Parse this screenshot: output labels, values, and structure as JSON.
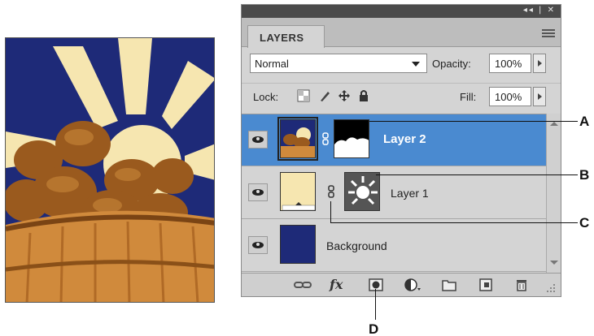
{
  "panel": {
    "tab_label": "LAYERS",
    "window_controls": "◂◂ | ✕",
    "blend_mode": "Normal",
    "opacity_label": "Opacity:",
    "opacity_value": "100%",
    "lock_label": "Lock:",
    "fill_label": "Fill:",
    "fill_value": "100%",
    "lock_icons": [
      "lock-transparent-pixels-icon",
      "lock-image-pixels-icon",
      "lock-position-icon",
      "lock-all-icon"
    ],
    "layers": [
      {
        "name": "Layer 2",
        "selected": true,
        "thumbnail": "potatoes-photo",
        "has_mask": true
      },
      {
        "name": "Layer 1",
        "selected": false,
        "thumbnail": "cream-fill",
        "has_mask": true,
        "mask": "sun-shape"
      },
      {
        "name": "Background",
        "selected": false,
        "thumbnail": "navy-fill",
        "has_mask": false
      }
    ],
    "bottom_icons": [
      "link-layers-icon",
      "fx-layer-style-icon",
      "add-mask-icon",
      "adjustment-layer-icon",
      "new-group-icon",
      "new-layer-icon",
      "delete-layer-icon"
    ],
    "fx_label": "fx"
  },
  "callouts": {
    "a": "A",
    "b": "B",
    "c": "C",
    "d": "D"
  },
  "colors": {
    "background_fill": "#1e2a78",
    "layer1_fill": "#f6e6b0",
    "selection": "#4a8ad0",
    "panel_bg": "#d4d4d4"
  }
}
